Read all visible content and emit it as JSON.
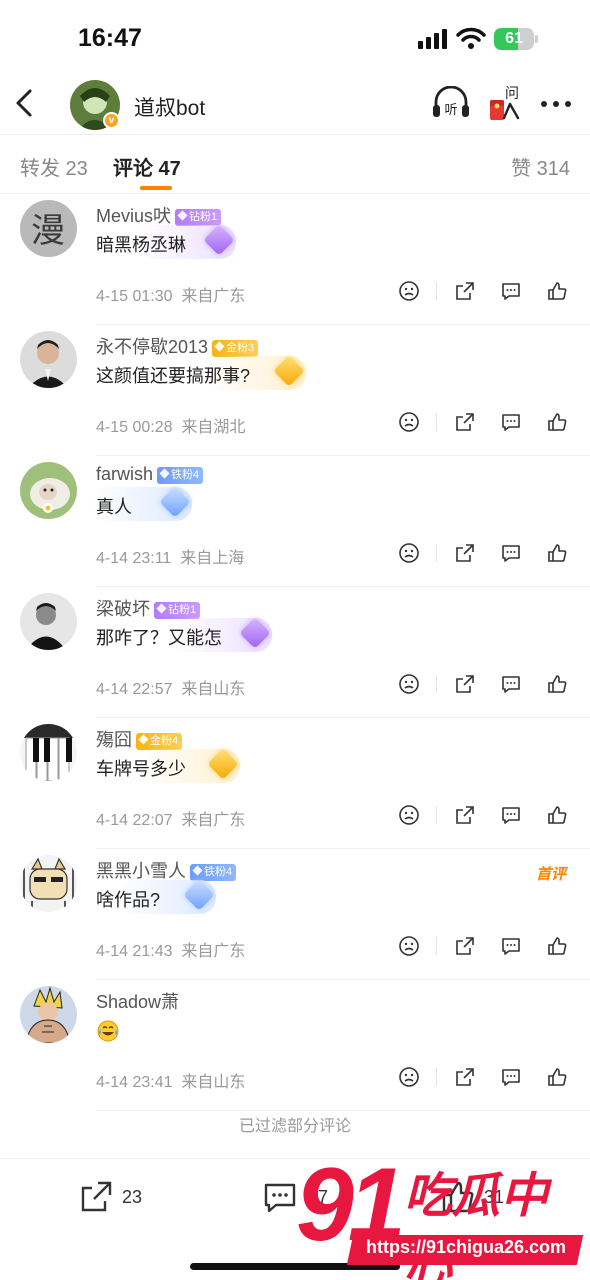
{
  "status_bar": {
    "time": "16:47",
    "battery": "61",
    "battery_level": 0.61
  },
  "nav": {
    "title": "道叔bot",
    "listen_label": "听",
    "ask_label": "问",
    "verified_badge": "v"
  },
  "tabs": {
    "repost": "转发 23",
    "comments": "评论 47",
    "likes": "赞 314"
  },
  "comments": [
    {
      "name": "Mevius吠",
      "badge": "钻粉1",
      "badge_type": "diamond",
      "text": "暗黑杨丞琳",
      "time": "4-15 01:30",
      "location": "来自广东"
    },
    {
      "name": "永不停歇2013",
      "badge": "金粉3",
      "badge_type": "gold",
      "text": "这颜值还要搞那事?",
      "time": "4-15 00:28",
      "location": "来自湖北"
    },
    {
      "name": "farwish",
      "badge": "铁粉4",
      "badge_type": "iron",
      "text": "真人",
      "time": "4-14 23:11",
      "location": "来自上海"
    },
    {
      "name": "梁破坏",
      "badge": "钻粉1",
      "badge_type": "diamond",
      "text": "那咋了？又能怎",
      "time": "4-14 22:57",
      "location": "来自山东"
    },
    {
      "name": "殤囧",
      "badge": "金粉4",
      "badge_type": "gold",
      "text": "车牌号多少",
      "time": "4-14 22:07",
      "location": "来自广东"
    },
    {
      "name": "黑黑小雪人",
      "badge": "铁粉4",
      "badge_type": "iron",
      "text": "啥作品?",
      "time": "4-14 21:43",
      "location": "来自广东",
      "tag": "首评"
    },
    {
      "name": "Shadow萧",
      "badge": "",
      "badge_type": "none",
      "text": "",
      "emoji": "laughing-crying",
      "time": "4-14 23:41",
      "location": "来自山东"
    }
  ],
  "filter_note": "已过滤部分评论",
  "bottom_bar": {
    "share_count": "23",
    "comment_count": "7",
    "like_count": "31"
  },
  "watermark": {
    "big": "91",
    "cn": "吃瓜中心",
    "url": "https://91chigua26.com"
  },
  "colors": {
    "accent": "#ff8200",
    "watermark": "#e8173f",
    "battery": "#34c759"
  }
}
